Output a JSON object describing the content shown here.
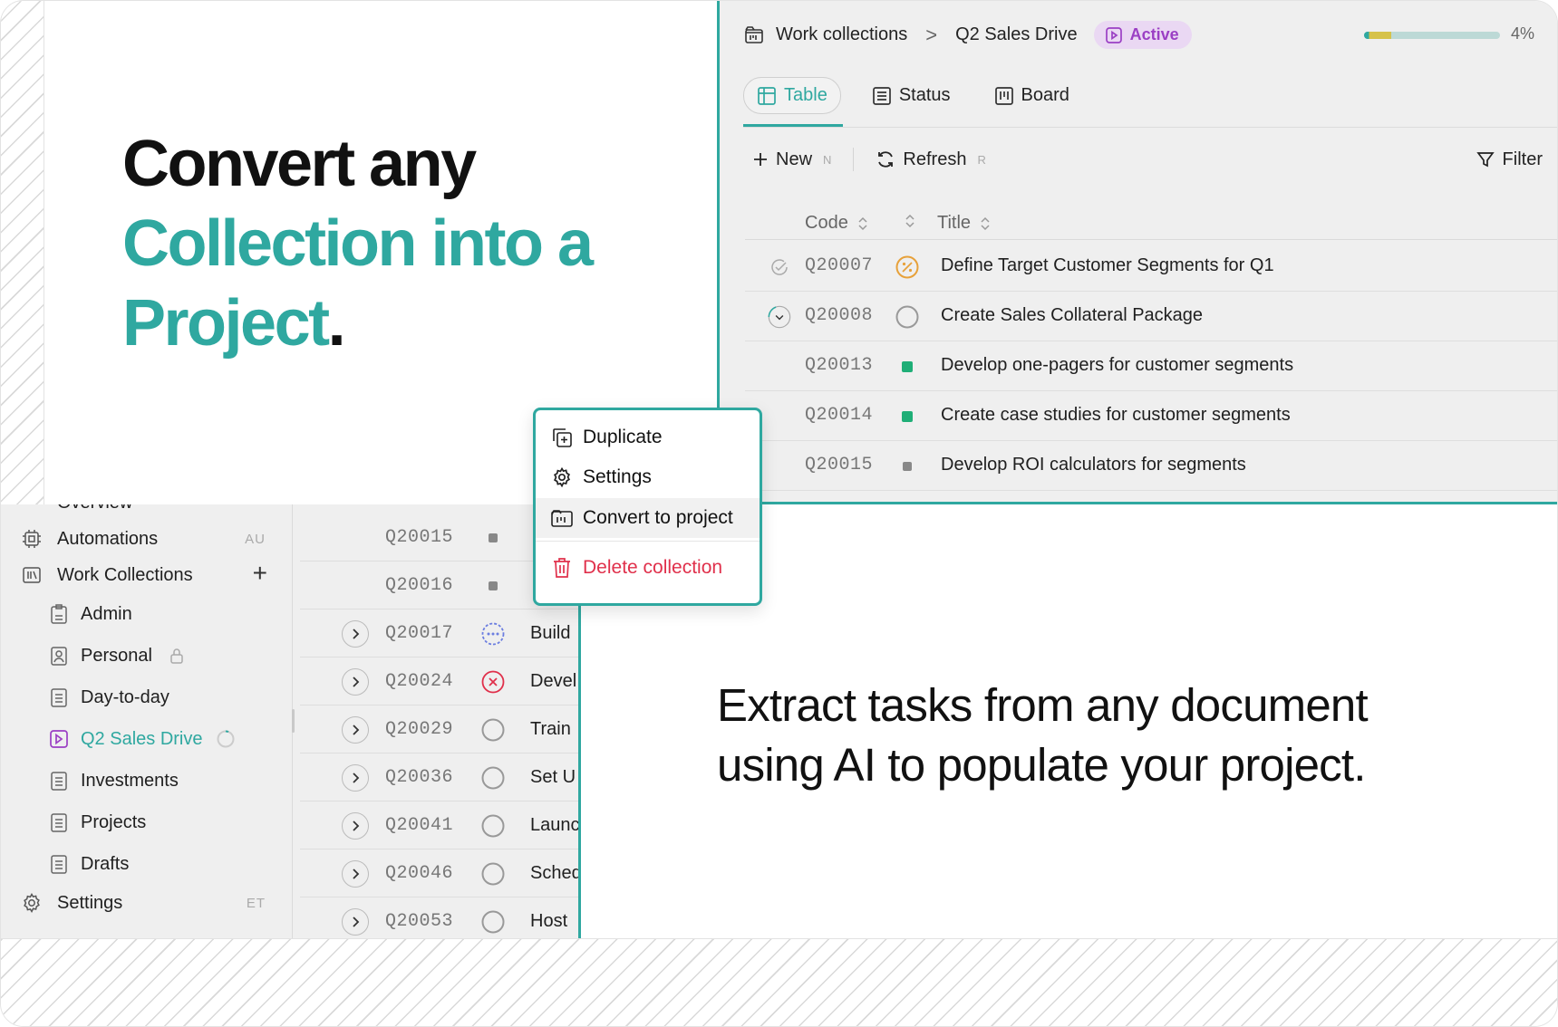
{
  "hero": {
    "line1": "Convert any",
    "line2": "Collection into a",
    "line3_teal": "Project",
    "line3_dot": "."
  },
  "subhead": {
    "line1": "Extract tasks from any document",
    "line2": "using AI to populate your project."
  },
  "header": {
    "breadcrumb_root": "Work collections",
    "breadcrumb_sep": ">",
    "breadcrumb_current": "Q2 Sales Drive",
    "status_badge": "Active",
    "progress_percent": 4,
    "progress_label": "4%"
  },
  "tabs": [
    {
      "label": "Table",
      "active": true
    },
    {
      "label": "Status",
      "active": false
    },
    {
      "label": "Board",
      "active": false
    }
  ],
  "toolbar": {
    "new_label": "New",
    "new_shortcut": "N",
    "refresh_label": "Refresh",
    "refresh_shortcut": "R",
    "filter_label": "Filter"
  },
  "table": {
    "col_code": "Code",
    "col_title": "Title",
    "rows": [
      {
        "code": "Q20007",
        "title": "Define Target Customer Segments for Q1",
        "status": "partial",
        "lead": "check"
      },
      {
        "code": "Q20008",
        "title": "Create Sales Collateral Package",
        "status": "empty",
        "lead": "expand"
      },
      {
        "code": "Q20013",
        "title": "Develop one-pagers for customer segments",
        "status": "done",
        "lead": "none"
      },
      {
        "code": "Q20014",
        "title": "Create case studies for customer segments",
        "status": "done",
        "lead": "none"
      },
      {
        "code": "Q20015",
        "title": "Develop ROI calculators for segments",
        "status": "todo",
        "lead": "none"
      }
    ]
  },
  "sidebar": {
    "partial_top": "Overview",
    "items": [
      {
        "label": "Automations",
        "shortcut": "AU",
        "icon": "cpu-icon"
      },
      {
        "label": "Work Collections",
        "icon": "collections-icon"
      },
      {
        "label": "Admin",
        "icon": "doc-icon"
      },
      {
        "label": "Personal",
        "icon": "person-doc-icon"
      },
      {
        "label": "Day-to-day",
        "icon": "doc-icon"
      },
      {
        "label": "Q2 Sales Drive",
        "icon": "project-icon"
      },
      {
        "label": "Investments",
        "icon": "doc-icon"
      },
      {
        "label": "Projects",
        "icon": "doc-icon"
      },
      {
        "label": "Drafts",
        "icon": "doc-icon"
      },
      {
        "label": "Settings",
        "shortcut": "ET",
        "icon": "gear-icon"
      }
    ],
    "add_label": "+"
  },
  "list": {
    "rows": [
      {
        "code": "Q20015",
        "title": "",
        "status": "todo",
        "chevron": false
      },
      {
        "code": "Q20016",
        "title": "",
        "status": "todo",
        "chevron": false
      },
      {
        "code": "Q20017",
        "title": "Build",
        "status": "dotted",
        "chevron": true
      },
      {
        "code": "Q20024",
        "title": "Devel",
        "status": "cancelled",
        "chevron": true
      },
      {
        "code": "Q20029",
        "title": "Train",
        "status": "empty",
        "chevron": true
      },
      {
        "code": "Q20036",
        "title": "Set U",
        "status": "empty",
        "chevron": true
      },
      {
        "code": "Q20041",
        "title": "Launc",
        "status": "empty",
        "chevron": true
      },
      {
        "code": "Q20046",
        "title": "Sched",
        "status": "empty",
        "chevron": true
      },
      {
        "code": "Q20053",
        "title": "Host",
        "status": "empty",
        "chevron": true
      }
    ]
  },
  "menu": {
    "items": [
      {
        "label": "Duplicate",
        "icon": "duplicate-icon"
      },
      {
        "label": "Settings",
        "icon": "gear-icon"
      },
      {
        "label": "Convert to project",
        "icon": "convert-icon"
      },
      {
        "label": "Delete collection",
        "icon": "trash-icon"
      }
    ]
  },
  "colors": {
    "accent": "#2fa8a0",
    "badge_bg": "#ead8f3",
    "badge_fg": "#9b3fc4",
    "danger": "#e0304b",
    "done": "#1fae77",
    "partial": "#e7a13a"
  }
}
